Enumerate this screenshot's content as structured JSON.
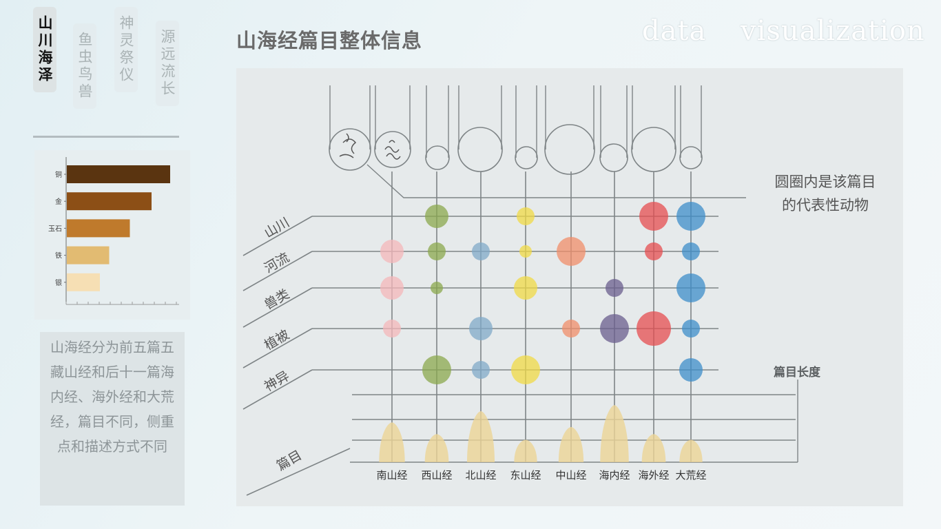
{
  "nav": {
    "tabs": [
      {
        "label": "山川海泽",
        "active": true
      },
      {
        "label": "鱼虫鸟兽",
        "active": false
      },
      {
        "label": "神灵祭仪",
        "active": false
      },
      {
        "label": "源远流长",
        "active": false
      }
    ]
  },
  "header": {
    "title": "山海经篇目整体信息",
    "watermark_1": "data",
    "watermark_2": "visualization"
  },
  "description": "山海经分为前五篇五藏山经和后十一篇海内经、海外经和大荒经，篇目不同，侧重点和描述方式不同",
  "chart_data": [
    {
      "type": "bar",
      "orientation": "horizontal",
      "categories": [
        "铜",
        "金",
        "玉石",
        "铁",
        "银"
      ],
      "values": [
        100,
        82,
        61,
        41,
        32
      ],
      "colors": [
        "#5a3410",
        "#8c4f16",
        "#bf7a2c",
        "#e2bb72",
        "#f6dfb4"
      ]
    },
    {
      "type": "scatter",
      "x_categories": [
        "南山经",
        "西山经",
        "北山经",
        "东山经",
        "中山经",
        "海内经",
        "海外经",
        "大荒经"
      ],
      "y_categories": [
        "山川",
        "河流",
        "兽类",
        "植被",
        "神异"
      ],
      "x_label": "篇目",
      "length_label": "篇目长度",
      "circle_note": "圆圈内是该篇目的代表性动物",
      "row_colors": {
        "南山经": "#f4b7b9",
        "西山经": "#8ba84e",
        "北山经": "#80a9c8",
        "东山经": "#f0da45",
        "中山经": "#f08d6a",
        "海内经": "#6a5d8e",
        "海外经": "#e64e50",
        "大荒经": "#3e8ec9"
      },
      "points": [
        {
          "x": "南山经",
          "y": "河流",
          "size": 3,
          "color": "#f4b7b9"
        },
        {
          "x": "南山经",
          "y": "兽类",
          "size": 3,
          "color": "#f4b7b9"
        },
        {
          "x": "南山经",
          "y": "植被",
          "size": 2,
          "color": "#f4b7b9"
        },
        {
          "x": "西山经",
          "y": "山川",
          "size": 3,
          "color": "#8ba84e"
        },
        {
          "x": "西山经",
          "y": "河流",
          "size": 2,
          "color": "#8ba84e"
        },
        {
          "x": "西山经",
          "y": "兽类",
          "size": 1,
          "color": "#8ba84e"
        },
        {
          "x": "西山经",
          "y": "神异",
          "size": 4,
          "color": "#8ba84e"
        },
        {
          "x": "北山经",
          "y": "河流",
          "size": 2,
          "color": "#80a9c8"
        },
        {
          "x": "北山经",
          "y": "植被",
          "size": 3,
          "color": "#80a9c8"
        },
        {
          "x": "北山经",
          "y": "神异",
          "size": 2,
          "color": "#80a9c8"
        },
        {
          "x": "东山经",
          "y": "山川",
          "size": 2,
          "color": "#f0da45"
        },
        {
          "x": "东山经",
          "y": "河流",
          "size": 1,
          "color": "#f0da45"
        },
        {
          "x": "东山经",
          "y": "兽类",
          "size": 3,
          "color": "#f0da45"
        },
        {
          "x": "东山经",
          "y": "神异",
          "size": 4,
          "color": "#f0da45"
        },
        {
          "x": "中山经",
          "y": "河流",
          "size": 4,
          "color": "#f08d6a"
        },
        {
          "x": "中山经",
          "y": "植被",
          "size": 2,
          "color": "#f08d6a"
        },
        {
          "x": "海内经",
          "y": "兽类",
          "size": 2,
          "color": "#6a5d8e"
        },
        {
          "x": "海内经",
          "y": "植被",
          "size": 4,
          "color": "#6a5d8e"
        },
        {
          "x": "海外经",
          "y": "山川",
          "size": 4,
          "color": "#e64e50"
        },
        {
          "x": "海外经",
          "y": "河流",
          "size": 2,
          "color": "#e64e50"
        },
        {
          "x": "海外经",
          "y": "植被",
          "size": 5,
          "color": "#e64e50"
        },
        {
          "x": "大荒经",
          "y": "山川",
          "size": 4,
          "color": "#3e8ec9"
        },
        {
          "x": "大荒经",
          "y": "河流",
          "size": 2,
          "color": "#3e8ec9"
        },
        {
          "x": "大荒经",
          "y": "兽类",
          "size": 4,
          "color": "#3e8ec9"
        },
        {
          "x": "大荒经",
          "y": "植被",
          "size": 2,
          "color": "#3e8ec9"
        },
        {
          "x": "大荒经",
          "y": "神异",
          "size": 3,
          "color": "#3e8ec9"
        }
      ],
      "lengths": [
        {
          "x": "南山经",
          "value": 78
        },
        {
          "x": "西山经",
          "value": 55
        },
        {
          "x": "北山经",
          "value": 100
        },
        {
          "x": "东山经",
          "value": 44
        },
        {
          "x": "中山经",
          "value": 69
        },
        {
          "x": "海内经",
          "value": 112
        },
        {
          "x": "海外经",
          "value": 55
        },
        {
          "x": "大荒经",
          "value": 44
        }
      ],
      "circle_sizes": [
        3,
        3,
        2,
        5,
        2,
        5,
        2,
        4,
        5,
        2
      ],
      "circle_icons": [
        "swirl-icon",
        "wave-icon"
      ]
    }
  ]
}
